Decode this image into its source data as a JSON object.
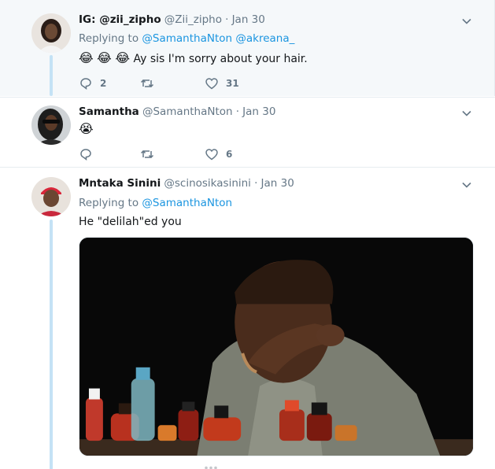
{
  "tweets": [
    {
      "name": "IG: @zii_zipho",
      "handle": "@Zii_zipho",
      "separator": "·",
      "date": "Jan 30",
      "replying_label": "Replying to",
      "replying_to": [
        "@SamanthaNton",
        "@akreana_"
      ],
      "emojis": [
        "😂",
        "😂",
        "😂"
      ],
      "text": "Ay sis I'm sorry about your hair.",
      "replies": "2",
      "retweets": "",
      "likes": "31"
    },
    {
      "name": "Samantha",
      "handle": "@SamanthaNton",
      "separator": "·",
      "date": "Jan 30",
      "emoji_text": "😭",
      "replies": "",
      "retweets": "",
      "likes": "6"
    },
    {
      "name": "Mntaka Sinini",
      "handle": "@scinosikasinini",
      "separator": "·",
      "date": "Jan 30",
      "replying_label": "Replying to",
      "replying_to": [
        "@SamanthaNton"
      ],
      "text": "He \"delilah\"ed you",
      "media_subject": "man wiping tears with hot sauce bottles on table"
    }
  ],
  "colors": {
    "link": "#1b95e0",
    "muted": "#657786",
    "thread": "#c4e2f5",
    "highlight_bg": "#f5f8fa"
  },
  "icons": [
    "reply-icon",
    "retweet-icon",
    "like-icon",
    "chevron-down-icon"
  ]
}
